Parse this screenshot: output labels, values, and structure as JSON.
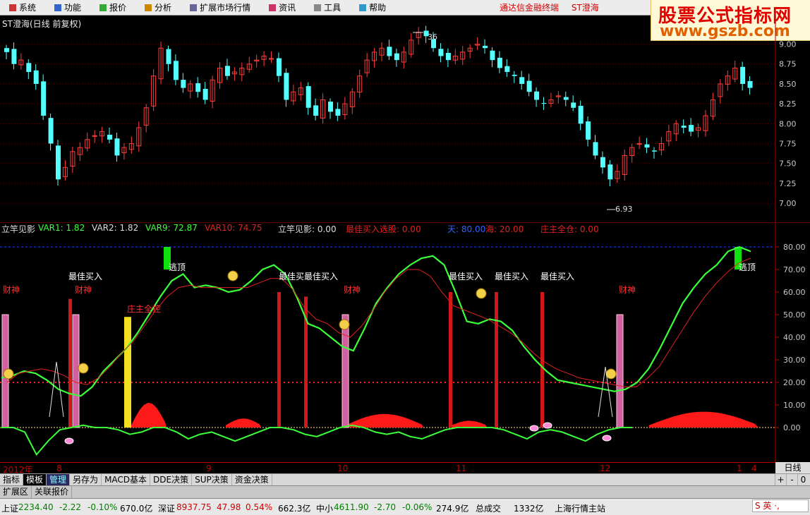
{
  "menu": [
    {
      "label": "系统",
      "icon": "system-icon"
    },
    {
      "label": "功能",
      "icon": "function-icon"
    },
    {
      "label": "报价",
      "icon": "quote-icon"
    },
    {
      "label": "分析",
      "icon": "analysis-icon"
    },
    {
      "label": "扩展市场行情",
      "icon": "market-icon"
    },
    {
      "label": "资讯",
      "icon": "news-icon"
    },
    {
      "label": "工具",
      "icon": "tools-icon"
    },
    {
      "label": "帮助",
      "icon": "help-icon"
    }
  ],
  "promo": {
    "terminal": "通达信金融终端",
    "stock": "ST澄海"
  },
  "logo": {
    "line1": "股票公式指标网",
    "line2": "www.gszb.com"
  },
  "stock_title": "ST澄海(日线 前复权)",
  "chart_data": [
    {
      "type": "candlestick",
      "ylim": [
        6.85,
        9.2
      ],
      "yticks": [
        "9.00",
        "8.75",
        "8.50",
        "8.25",
        "8.00",
        "7.75",
        "7.50",
        "7.25",
        "7.00"
      ],
      "annotations": {
        "high": "36",
        "low": "6.93"
      },
      "closes": [
        8.9,
        8.75,
        8.8,
        8.65,
        8.5,
        8.1,
        7.75,
        7.3,
        7.45,
        7.65,
        7.7,
        7.8,
        7.85,
        7.9,
        7.8,
        7.6,
        7.7,
        7.75,
        7.95,
        8.2,
        8.6,
        8.95,
        8.75,
        8.55,
        8.45,
        8.5,
        8.4,
        8.3,
        8.55,
        8.7,
        8.6,
        8.65,
        8.7,
        8.75,
        8.8,
        8.85,
        8.82,
        8.6,
        8.3,
        8.4,
        8.45,
        8.2,
        8.1,
        8.3,
        8.15,
        8.1,
        8.25,
        8.4,
        8.6,
        8.8,
        8.9,
        8.95,
        8.85,
        8.8,
        8.9,
        9.05,
        9.15,
        9.1,
        8.95,
        8.85,
        8.8,
        8.85,
        8.9,
        8.95,
        9.0,
        8.95,
        8.8,
        8.7,
        8.65,
        8.6,
        8.5,
        8.4,
        8.3,
        8.25,
        8.3,
        8.35,
        8.3,
        8.2,
        8.0,
        7.8,
        7.6,
        7.45,
        7.3,
        7.4,
        7.6,
        7.7,
        7.75,
        7.7,
        7.65,
        7.75,
        7.9,
        8.0,
        7.95,
        7.9,
        7.95,
        8.1,
        8.3,
        8.5,
        8.6,
        8.7,
        8.5,
        8.45
      ]
    },
    {
      "type": "line",
      "ylim": [
        -15,
        85
      ],
      "yticks": [
        "80.00",
        "70.00",
        "60.00",
        "50.00",
        "40.00",
        "30.00",
        "20.00",
        "10.00",
        "0.00"
      ],
      "series": [
        {
          "name": "VAR1",
          "color": "#3aff3a",
          "values": [
            22,
            23,
            25,
            24,
            21,
            17,
            15,
            14,
            18,
            25,
            30,
            35,
            42,
            50,
            58,
            65,
            68,
            62,
            63,
            62,
            60,
            61,
            65,
            70,
            72,
            68,
            58,
            46,
            44,
            40,
            36,
            34,
            44,
            55,
            62,
            68,
            72,
            75,
            76,
            72,
            60,
            47,
            46,
            48,
            47,
            43,
            36,
            30,
            25,
            21,
            20,
            19,
            18,
            17,
            16,
            17,
            20,
            26,
            35,
            45,
            55,
            62,
            68,
            72,
            78,
            80,
            78
          ]
        },
        {
          "name": "VAR2",
          "color": "#e02020",
          "values": [
            20,
            24,
            25,
            26,
            25,
            23,
            20,
            19,
            22,
            27,
            33,
            38,
            45,
            52,
            58,
            62,
            63,
            62,
            62,
            62,
            62,
            62,
            64,
            66,
            66,
            61,
            53,
            48,
            46,
            42,
            40,
            45,
            52,
            60,
            66,
            70,
            70,
            67,
            60,
            54,
            52,
            50,
            48,
            45,
            42,
            38,
            33,
            29,
            26,
            24,
            22,
            21,
            20,
            19,
            18,
            18,
            22,
            27,
            35,
            43,
            51,
            58,
            64,
            69,
            73,
            75
          ]
        },
        {
          "name": "VAR9",
          "color": "#3aff3a",
          "values": [
            0,
            0,
            -2,
            -12,
            -6,
            -1,
            0,
            1,
            0,
            0,
            -1,
            -3,
            -2,
            0,
            0,
            -2,
            -5,
            -3,
            -2,
            -4,
            -6,
            -4,
            -2,
            0,
            0,
            -1,
            -3,
            -4,
            -2,
            0,
            1,
            0,
            -2,
            -3,
            -2,
            -4,
            -5,
            -3,
            -1,
            0,
            0,
            0,
            0,
            -1,
            -3,
            -5,
            -2,
            -1,
            -2,
            -4,
            -6,
            -3,
            -1,
            0,
            0
          ]
        }
      ],
      "levels": {
        "tian": 80,
        "hai": 20
      },
      "signals": [
        "逃顶",
        "最佳买入",
        "财神",
        "庄主全控"
      ]
    }
  ],
  "legend": {
    "l1": "立竿见影",
    "var1": "VAR1: 1.82",
    "var2": "VAR2: 1.82",
    "var9": "VAR9: 72.87",
    "var10": "VAR10: 74.75",
    "l2": "立竿见影: 0.00",
    "best": "最佳买入选股: 0.00",
    "tian": "天: 80.00",
    "hai": "海: 20.00",
    "zhuang": "庄主全仓: 0.00"
  },
  "labels": {
    "taoding": "逃顶",
    "zuijia": "最佳买入",
    "zuijia2": "最佳买最佳买入",
    "caishen": "财神",
    "zhuangzhu": "庄主全控"
  },
  "dates": [
    "2012年",
    "8",
    "9",
    "10",
    "11",
    "12",
    "1",
    "4"
  ],
  "period": "日线",
  "tabs1": [
    "指标",
    "模板",
    "管理",
    "另存为",
    "MACD基本",
    "DDE决策",
    "SUP决策",
    "资金决策"
  ],
  "tabs1_ctl": [
    "+",
    "-",
    "0"
  ],
  "tabs2": [
    "扩展区",
    "关联报价"
  ],
  "status": {
    "sh_label": "上证",
    "sh_val": "2234.40",
    "sh_chg": "-2.22",
    "sh_pct": "-0.10%",
    "sh_amt": "670.0亿",
    "sz_label": "深证",
    "sz_val": "8937.75",
    "sz_chg": "47.98",
    "sz_pct": "0.54%",
    "sz_amt": "662.3亿",
    "zx_label": "中小",
    "zx_val": "4611.90",
    "zx_chg": "-2.70",
    "zx_pct": "-0.06%",
    "zx_amt": "274.9亿",
    "total_label": "总成交",
    "total_val": "1332亿",
    "site": "上海行情主站"
  },
  "ime": "S 英 ·,"
}
